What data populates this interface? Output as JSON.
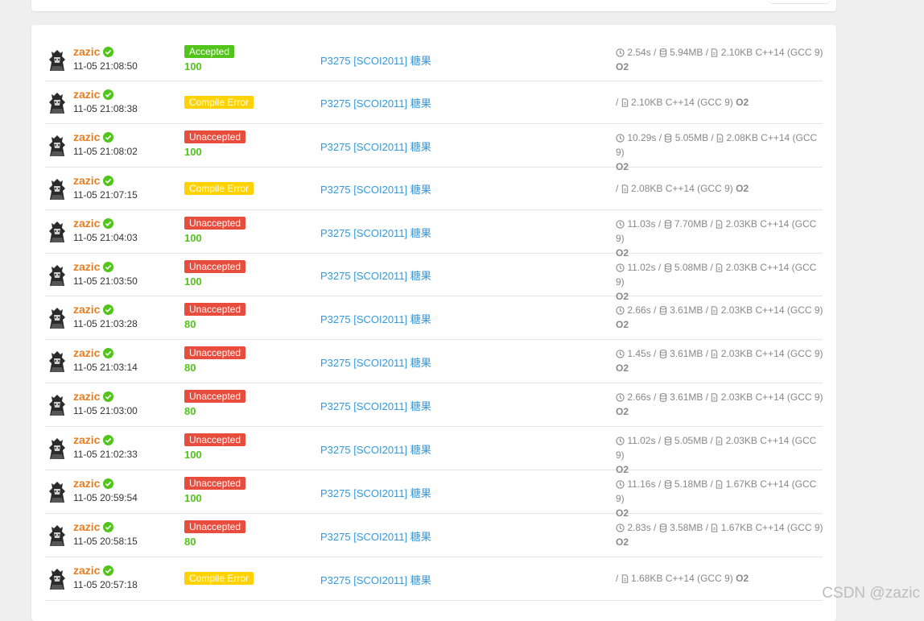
{
  "watermark": "CSDN @zazic",
  "problem_title": "P3275 [SCOI2011] 糖果",
  "submissions": [
    {
      "user": "zazic",
      "time": "11-05 21:08:50",
      "status": "Accepted",
      "status_type": "ac",
      "score": "100",
      "time_used": "2.54s",
      "memory": "5.94MB",
      "code_size": "2.10KB",
      "lang": "C++14 (GCC 9)",
      "opt": "O2"
    },
    {
      "user": "zazic",
      "time": "11-05 21:08:38",
      "status": "Compile Error",
      "status_type": "ce",
      "score": "",
      "time_used": "",
      "memory": "",
      "code_size": "2.10KB",
      "lang": "C++14 (GCC 9)",
      "opt": "O2"
    },
    {
      "user": "zazic",
      "time": "11-05 21:08:02",
      "status": "Unaccepted",
      "status_type": "ua",
      "score": "100",
      "time_used": "10.29s",
      "memory": "5.05MB",
      "code_size": "2.08KB",
      "lang": "C++14 (GCC 9)",
      "opt": "O2"
    },
    {
      "user": "zazic",
      "time": "11-05 21:07:15",
      "status": "Compile Error",
      "status_type": "ce",
      "score": "",
      "time_used": "",
      "memory": "",
      "code_size": "2.08KB",
      "lang": "C++14 (GCC 9)",
      "opt": "O2"
    },
    {
      "user": "zazic",
      "time": "11-05 21:04:03",
      "status": "Unaccepted",
      "status_type": "ua",
      "score": "100",
      "time_used": "11.03s",
      "memory": "7.70MB",
      "code_size": "2.03KB",
      "lang": "C++14 (GCC 9)",
      "opt": "O2"
    },
    {
      "user": "zazic",
      "time": "11-05 21:03:50",
      "status": "Unaccepted",
      "status_type": "ua",
      "score": "100",
      "time_used": "11.02s",
      "memory": "5.08MB",
      "code_size": "2.03KB",
      "lang": "C++14 (GCC 9)",
      "opt": "O2"
    },
    {
      "user": "zazic",
      "time": "11-05 21:03:28",
      "status": "Unaccepted",
      "status_type": "ua",
      "score": "80",
      "time_used": "2.66s",
      "memory": "3.61MB",
      "code_size": "2.03KB",
      "lang": "C++14 (GCC 9)",
      "opt": "O2"
    },
    {
      "user": "zazic",
      "time": "11-05 21:03:14",
      "status": "Unaccepted",
      "status_type": "ua",
      "score": "80",
      "time_used": "1.45s",
      "memory": "3.61MB",
      "code_size": "2.03KB",
      "lang": "C++14 (GCC 9)",
      "opt": "O2"
    },
    {
      "user": "zazic",
      "time": "11-05 21:03:00",
      "status": "Unaccepted",
      "status_type": "ua",
      "score": "80",
      "time_used": "2.66s",
      "memory": "3.61MB",
      "code_size": "2.03KB",
      "lang": "C++14 (GCC 9)",
      "opt": "O2"
    },
    {
      "user": "zazic",
      "time": "11-05 21:02:33",
      "status": "Unaccepted",
      "status_type": "ua",
      "score": "100",
      "time_used": "11.02s",
      "memory": "5.05MB",
      "code_size": "2.03KB",
      "lang": "C++14 (GCC 9)",
      "opt": "O2"
    },
    {
      "user": "zazic",
      "time": "11-05 20:59:54",
      "status": "Unaccepted",
      "status_type": "ua",
      "score": "100",
      "time_used": "11.16s",
      "memory": "5.18MB",
      "code_size": "1.67KB",
      "lang": "C++14 (GCC 9)",
      "opt": "O2"
    },
    {
      "user": "zazic",
      "time": "11-05 20:58:15",
      "status": "Unaccepted",
      "status_type": "ua",
      "score": "80",
      "time_used": "2.83s",
      "memory": "3.58MB",
      "code_size": "1.67KB",
      "lang": "C++14 (GCC 9)",
      "opt": "O2"
    },
    {
      "user": "zazic",
      "time": "11-05 20:57:18",
      "status": "Compile Error",
      "status_type": "ce",
      "score": "",
      "time_used": "",
      "memory": "",
      "code_size": "1.68KB",
      "lang": "C++14 (GCC 9)",
      "opt": "O2"
    }
  ],
  "colors": {
    "accepted": "#52c41a",
    "unaccepted": "#e74c3c",
    "compile_error": "#ffd200",
    "username": "#e67e22",
    "link": "#3498db"
  },
  "icons": {
    "time": "clock-icon",
    "memory": "database-icon",
    "code": "file-icon",
    "verified": "check-circle-icon",
    "avatar": "user-avatar"
  }
}
